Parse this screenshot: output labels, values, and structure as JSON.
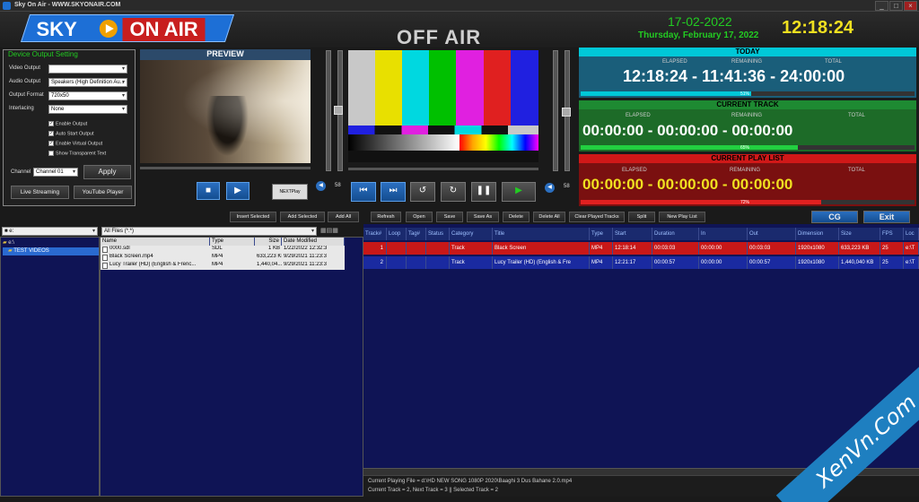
{
  "window": {
    "title": "Sky On Air - WWW.SKYONAIR.COM",
    "min": "_",
    "max": "□",
    "close": "×"
  },
  "header": {
    "logo_sky": "SKY",
    "logo_onair": "ON AIR",
    "status": "OFF AIR",
    "date_short": "17-02-2022",
    "date_long": "Thursday, February 17, 2022",
    "clock": "12:18:24"
  },
  "device_settings": {
    "title": "Device Output Setting",
    "video_output_label": "Video Output",
    "video_output_value": "",
    "audio_output_label": "Audio Output",
    "audio_output_value": "Speakers (High Definition Au...",
    "output_format_label": "Output Format",
    "output_format_value": "720x50",
    "interlacing_label": "Interlacing",
    "interlacing_value": "None",
    "checks": [
      {
        "label": "Enable Output",
        "checked": true
      },
      {
        "label": "Auto Start Output",
        "checked": true
      },
      {
        "label": "Enable Virtual Output",
        "checked": true
      },
      {
        "label": "Show Transparent Text",
        "checked": false
      }
    ],
    "channel_label": "Channel",
    "channel_value": "Channel 01",
    "apply": "Apply",
    "live_streaming": "Live Streaming",
    "youtube_player": "YouTube Player"
  },
  "preview": {
    "title": "PREVIEW",
    "vol_val": "58",
    "next_play": "NEXTPlay"
  },
  "output": {
    "vol_val": "58"
  },
  "today": {
    "title": "TODAY",
    "elapsed_label": "ELAPSED",
    "remaining_label": "REMAINING",
    "total_label": "TOTAL",
    "time": "12:18:24 - 11:41:36 - 24:00:00",
    "percent": "51%",
    "progress": 0.51
  },
  "current_track": {
    "title": "CURRENT TRACK",
    "elapsed_label": "ELAPSED",
    "remaining_label": "REMAINING",
    "total_label": "TOTAL",
    "time": "00:00:00 - 00:00:00 - 00:00:00",
    "percent": "65%",
    "progress": 0.65
  },
  "current_playlist": {
    "title": "CURRENT PLAY LIST",
    "elapsed_label": "ELAPSED",
    "remaining_label": "REMAINING",
    "total_label": "TOTAL",
    "time": "00:00:00 - 00:00:00 - 00:00:00",
    "percent": "72%",
    "progress": 0.72
  },
  "toolbar_left": {
    "insert": "Insert Selected",
    "add": "Add Selected",
    "addall": "Add All"
  },
  "toolbar_right": {
    "refresh": "Refresh",
    "open": "Open",
    "save": "Save",
    "saveas": "Save As",
    "delete": "Delete",
    "deleteall": "Delete All",
    "clear": "Clear Played Tracks",
    "split": "Split",
    "newpl": "New Play List",
    "cg": "CG",
    "exit": "Exit"
  },
  "tree": {
    "drive": "■ e:",
    "root": "e:\\",
    "folder": "TEST VIDEOS"
  },
  "files": {
    "filter": "All Files (*.*)",
    "columns": [
      "Name",
      "Type",
      "Size",
      "Date Modified"
    ],
    "rows": [
      [
        "0000.sdl",
        "SDL",
        "1 KB",
        "1/22/2022 12:32:3"
      ],
      [
        "Black Screen.mp4",
        "MP4",
        "633,223 KB",
        "9/29/2021 11:23:3"
      ],
      [
        "Lucy Trailer (HD) (English & Frenc...",
        "MP4",
        "1,440,04...",
        "9/29/2021 11:23:3"
      ]
    ]
  },
  "playlist": {
    "columns": [
      "Track#",
      "Loop",
      "Tag#",
      "Status",
      "Category",
      "Title",
      "Type",
      "Start",
      "Duration",
      "In",
      "Out",
      "Dimension",
      "Size",
      "FPS",
      "Loc"
    ],
    "rows": [
      [
        "1",
        "",
        "",
        "",
        "Track",
        "Black Screen",
        "MP4",
        "12:18:14",
        "00:03:03",
        "00:00:00",
        "00:03:03",
        "1920x1080",
        "633,223 KB",
        "25",
        "e:\\T"
      ],
      [
        "2",
        "",
        "",
        "",
        "Track",
        "Lucy Trailer (HD) (English & Fre",
        "MP4",
        "12:21:17",
        "00:00:57",
        "00:00:00",
        "00:00:57",
        "1920x1080",
        "1,440,040 KB",
        "25",
        "e:\\T"
      ]
    ]
  },
  "status": {
    "playing": "Current Playing File = d:\\HD NEW SONG 1080P 2020\\Baaghi 3  Dus Bahane 2.0.mp4",
    "tracks": "Current Track = 2, Next Track = 3  ||  Selected Track = 2"
  },
  "watermark": "XenVn.Com"
}
